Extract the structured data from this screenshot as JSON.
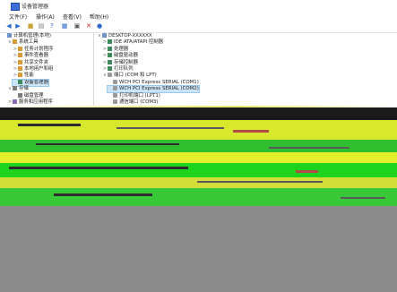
{
  "window": {
    "title": "设备管理器"
  },
  "menu": {
    "items": [
      "文件(F)",
      "操作(A)",
      "查看(V)",
      "帮助(H)"
    ]
  },
  "toolbar": {
    "icons": [
      "back-icon",
      "forward-icon",
      "folder-icon",
      "properties-icon",
      "help-icon",
      "refresh-icon",
      "scan-icon",
      "remove-icon",
      "update-icon"
    ]
  },
  "left_tree": [
    {
      "label": "计算机管理(本地)",
      "indent": 0,
      "twisty": "",
      "icon": "comp"
    },
    {
      "label": "系统工具",
      "indent": 1,
      "twisty": "∨",
      "icon": "tool"
    },
    {
      "label": "任务计划程序",
      "indent": 2,
      "twisty": ">",
      "icon": "tool"
    },
    {
      "label": "事件查看器",
      "indent": 2,
      "twisty": ">",
      "icon": "tool"
    },
    {
      "label": "共享文件夹",
      "indent": 2,
      "twisty": ">",
      "icon": "tool"
    },
    {
      "label": "本地用户和组",
      "indent": 2,
      "twisty": ">",
      "icon": "tool"
    },
    {
      "label": "性能",
      "indent": 2,
      "twisty": ">",
      "icon": "tool"
    },
    {
      "label": "设备管理器",
      "indent": 2,
      "twisty": "",
      "icon": "dev",
      "selected": true
    },
    {
      "label": "存储",
      "indent": 1,
      "twisty": "∨",
      "icon": "store"
    },
    {
      "label": "磁盘管理",
      "indent": 2,
      "twisty": "",
      "icon": "store"
    },
    {
      "label": "服务和应用程序",
      "indent": 1,
      "twisty": ">",
      "icon": "svc"
    }
  ],
  "right_tree": [
    {
      "label": "DESKTOP-XXXXXX",
      "indent": 0,
      "twisty": "∨",
      "icon": "comp"
    },
    {
      "label": "IDE ATA/ATAPI 控制器",
      "indent": 1,
      "twisty": ">",
      "icon": "dev"
    },
    {
      "label": "处理器",
      "indent": 1,
      "twisty": ">",
      "icon": "dev"
    },
    {
      "label": "磁盘驱动器",
      "indent": 1,
      "twisty": ">",
      "icon": "dev"
    },
    {
      "label": "存储控制器",
      "indent": 1,
      "twisty": ">",
      "icon": "dev"
    },
    {
      "label": "打印队列",
      "indent": 1,
      "twisty": ">",
      "icon": "dev"
    },
    {
      "label": "端口 (COM 和 LPT)",
      "indent": 1,
      "twisty": "∨",
      "icon": "port"
    },
    {
      "label": "WCH PCI Express SERIAL (COM1)",
      "indent": 2,
      "twisty": "",
      "icon": "port"
    },
    {
      "label": "WCH PCI Express SERIAL (COM2)",
      "indent": 2,
      "twisty": "",
      "icon": "port",
      "selected": true
    },
    {
      "label": "打印机端口 (LPT1)",
      "indent": 2,
      "twisty": "",
      "icon": "port"
    },
    {
      "label": "通信端口 (COM3)",
      "indent": 2,
      "twisty": "",
      "icon": "port"
    }
  ]
}
